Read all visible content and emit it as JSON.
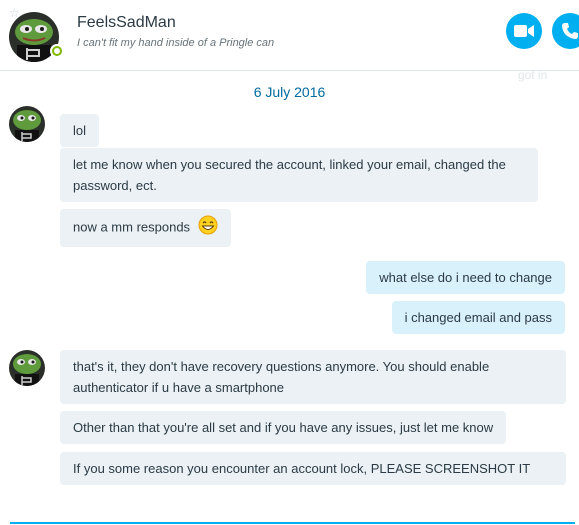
{
  "contact": {
    "name": "FeelsSadMan",
    "mood": "I can't fit my hand inside of a Pringle can"
  },
  "header_actions": {
    "video_icon": "video-camera-icon",
    "call_icon": "phone-icon"
  },
  "faded_text": "got in",
  "date_separator": "6 July 2016",
  "messages": [
    {
      "direction": "in",
      "text": "lol"
    },
    {
      "direction": "in",
      "text": "let me know when you secured the account, linked your email, changed the password, ect."
    },
    {
      "direction": "in",
      "text": "now a mm responds",
      "emoticon": "laughing-emoticon"
    },
    {
      "direction": "out",
      "text": "what else do i need to change"
    },
    {
      "direction": "out",
      "text": "i changed email and pass"
    },
    {
      "direction": "in",
      "text": "that's it, they don't have recovery questions anymore. You should enable authenticator if u have a smartphone"
    },
    {
      "direction": "in",
      "text": "Other than that you're all set and if you have any issues, just let me know"
    },
    {
      "direction": "in",
      "text": "If you some reason you encounter an account lock, PLEASE SCREENSHOT IT"
    }
  ],
  "colors": {
    "accent": "#00aff0",
    "incoming_bubble": "#ebf1f4",
    "outgoing_bubble": "#d9f1fb",
    "date_text": "#006a9e",
    "presence": "#7fba00"
  }
}
